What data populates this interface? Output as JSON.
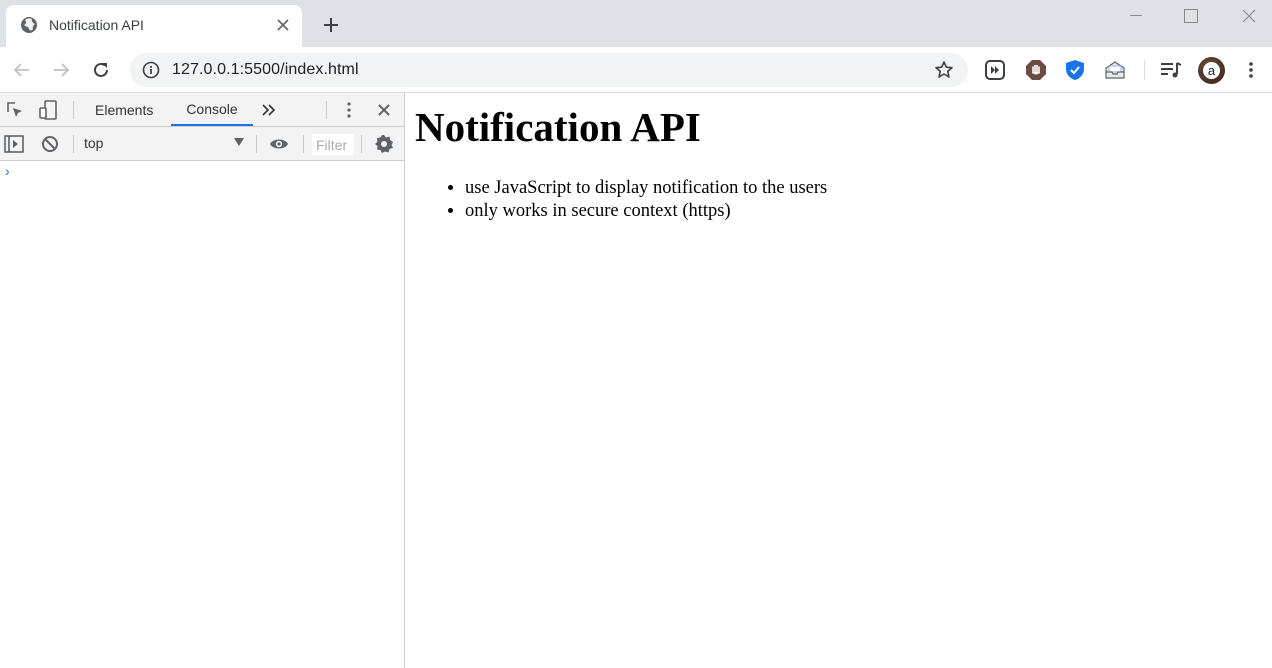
{
  "tab": {
    "title": "Notification API",
    "favicon": "globe-icon"
  },
  "window_controls": [
    "minimize-icon",
    "maximize-icon",
    "close-icon"
  ],
  "toolbar": {
    "url": "127.0.0.1:5500/index.html",
    "extensions": [
      "media-extension-icon",
      "stop-hand-icon",
      "shield-icon",
      "inbox-icon",
      "media-controls-icon"
    ],
    "avatar_letter": "a"
  },
  "devtools": {
    "tabs": [
      {
        "label": "Elements",
        "active": false
      },
      {
        "label": "Console",
        "active": true
      }
    ],
    "context": "top",
    "filter_placeholder": "Filter",
    "prompt_symbol": "›"
  },
  "page": {
    "heading": "Notification API",
    "bullets": [
      "use JavaScript to display notification to the users",
      "only works in secure context (https)"
    ]
  },
  "colors": {
    "accent": "#1a73e8",
    "tabstrip": "#dee1e6",
    "omnibox": "#f1f3f4",
    "devtools_bar": "#f3f3f3"
  }
}
